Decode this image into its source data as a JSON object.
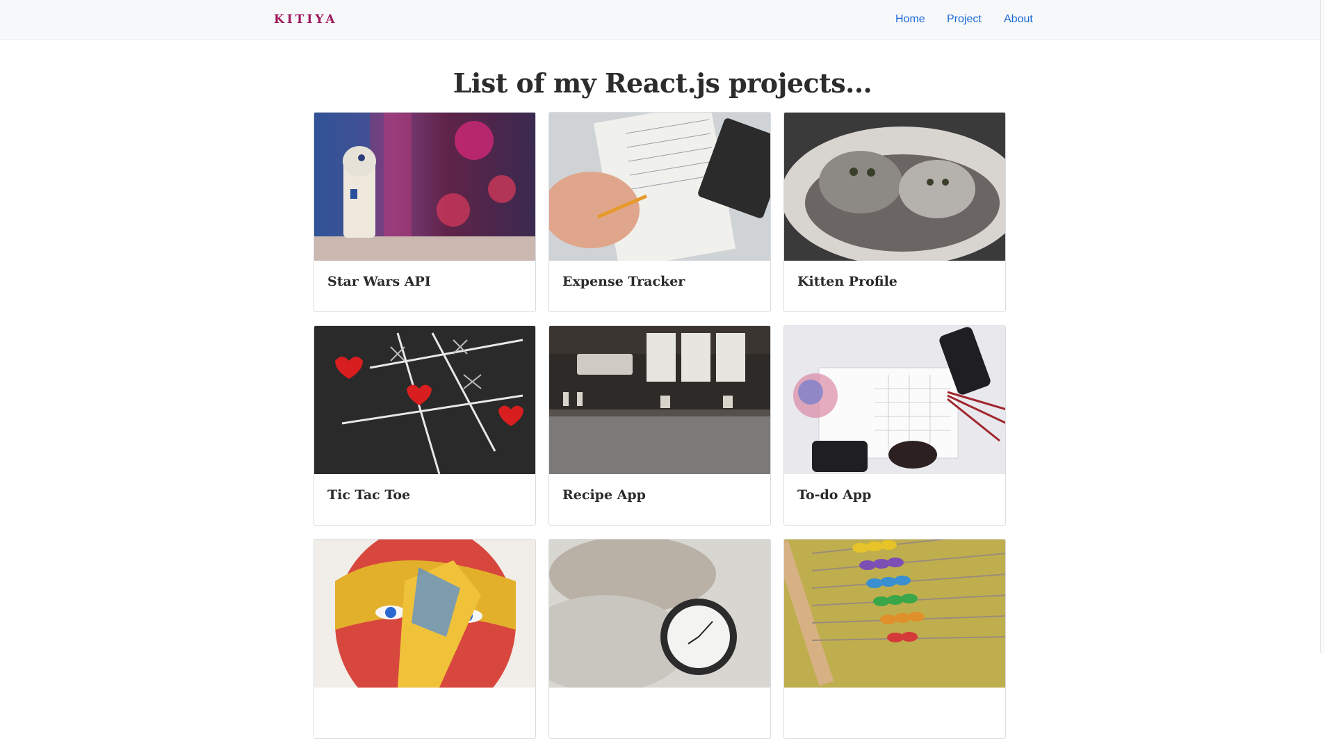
{
  "navbar": {
    "brand": "KITIYA",
    "links": [
      "Home",
      "Project",
      "About"
    ]
  },
  "heading": "List of my React.js projects...",
  "projects": [
    {
      "title": "Star Wars API",
      "image": "r2d2-toy-photo"
    },
    {
      "title": "Expense Tracker",
      "image": "receipts-calculator-photo"
    },
    {
      "title": "Kitten Profile",
      "image": "kittens-in-bed-photo"
    },
    {
      "title": "Tic Tac Toe",
      "image": "chalk-tictactoe-hearts-photo"
    },
    {
      "title": "Recipe App",
      "image": "cafe-counter-photo"
    },
    {
      "title": "To-do App",
      "image": "calendar-planner-photo"
    },
    {
      "title": "",
      "image": "painted-face-photo"
    },
    {
      "title": "",
      "image": "pocket-watch-photo"
    },
    {
      "title": "",
      "image": "abacus-photo"
    }
  ],
  "colors": {
    "brand": "#a0185e",
    "link": "#1a6ad9",
    "navbar_bg": "#f7f8fa"
  }
}
